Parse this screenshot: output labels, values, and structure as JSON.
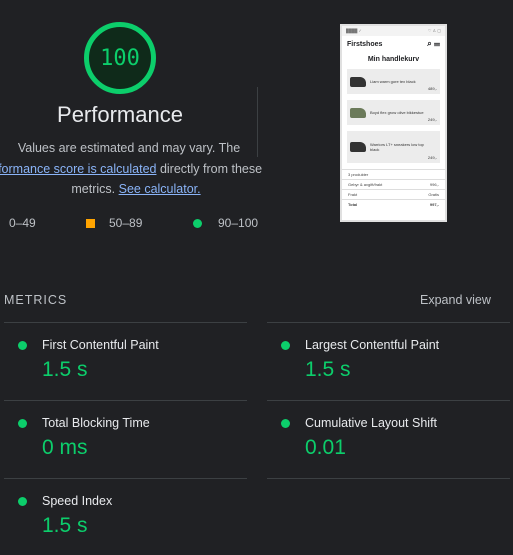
{
  "score": {
    "value": "100",
    "title": "Performance"
  },
  "description": {
    "line1": "Values are estimated and may vary. The",
    "link1": "performance score is calculated",
    "mid": " directly from these",
    "lead2": "metrics. ",
    "link2": "See calculator."
  },
  "legend": [
    {
      "label": "0–49"
    },
    {
      "label": "50–89"
    },
    {
      "label": "90–100"
    }
  ],
  "preview": {
    "store": "Firstshoes",
    "page_title": "Min handlekurv",
    "items": [
      {
        "name": "Liam warm gore tex black",
        "price": "489,-"
      },
      {
        "name": "Boyd flex grow olive bikkestue",
        "price": "249,-"
      },
      {
        "name": "Warriors LT+ sneakers low top black",
        "price": "249,-"
      }
    ],
    "summary": [
      {
        "label": "3 produkter",
        "value": ""
      },
      {
        "label": "Gebyr & avgift/frakt",
        "value": "996,-"
      },
      {
        "label": "Frakt",
        "value": "Gratis"
      },
      {
        "label": "Total",
        "value": "997,-"
      }
    ]
  },
  "metrics_section": {
    "heading": "METRICS",
    "expand": "Expand view"
  },
  "metrics": [
    {
      "label": "First Contentful Paint",
      "value": "1.5 s"
    },
    {
      "label": "Largest Contentful Paint",
      "value": "1.5 s"
    },
    {
      "label": "Total Blocking Time",
      "value": "0 ms"
    },
    {
      "label": "Cumulative Layout Shift",
      "value": "0.01"
    },
    {
      "label": "Speed Index",
      "value": "1.5 s"
    }
  ],
  "colors": {
    "good": "#0cce6b",
    "average": "#ffa400",
    "poor": "#ff4e42",
    "link": "#8ab4f8"
  }
}
